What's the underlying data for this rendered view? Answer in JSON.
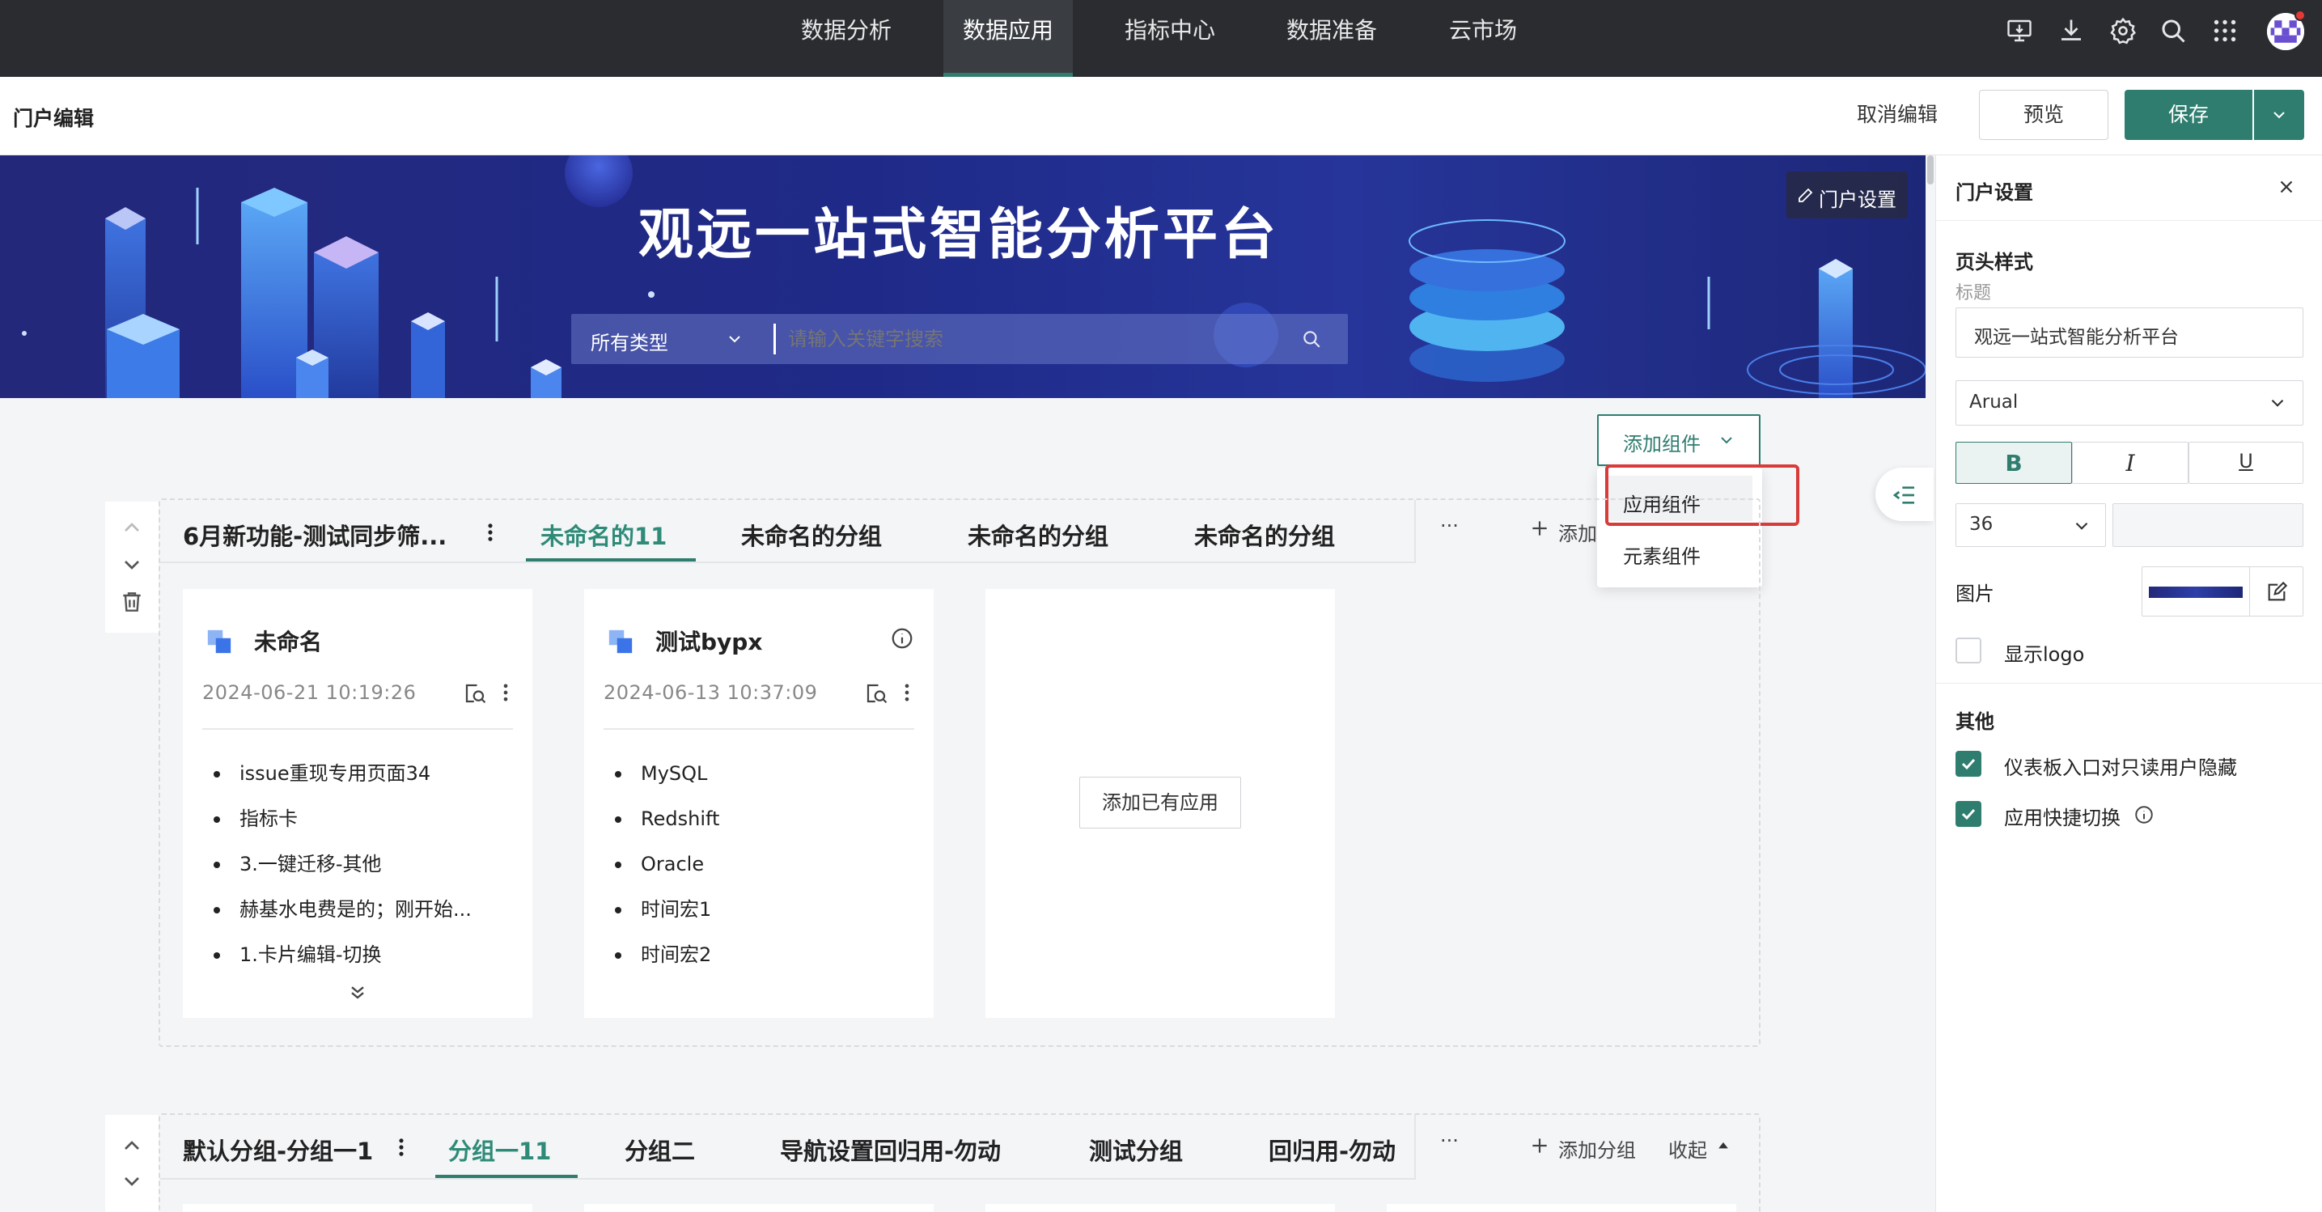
{
  "nav": {
    "items": [
      {
        "label": "数据分析"
      },
      {
        "label": "数据应用"
      },
      {
        "label": "指标中心"
      },
      {
        "label": "数据准备"
      },
      {
        "label": "云市场"
      }
    ],
    "active_index": 1
  },
  "toolbar": {
    "title": "门户编辑",
    "cancel_label": "取消编辑",
    "preview_label": "预览",
    "save_label": "保存"
  },
  "banner": {
    "title": "观远一站式智能分析平台",
    "type_select": "所有类型",
    "search_placeholder": "请输入关键字搜索",
    "settings_label": "门户设置"
  },
  "add_component": {
    "label": "添加组件",
    "menu": [
      "应用组件",
      "元素组件"
    ]
  },
  "group1": {
    "name": "6月新功能-测试同步筛...",
    "tabs": [
      "未命名的11",
      "未命名的分组",
      "未命名的分组",
      "未命名的分组"
    ],
    "active_tab": 0,
    "more": "···",
    "add_group_truncated": "添加",
    "cards": [
      {
        "title": "未命名",
        "date": "2024-06-21 10:19:26",
        "items": [
          "issue重现专用页面34",
          "指标卡",
          "3.一键迁移-其他",
          "赫基水电费是的；刚开始...",
          "1.卡片编辑-切换"
        ]
      },
      {
        "title": "测试bypx",
        "date": "2024-06-13 10:37:09",
        "items": [
          "MySQL",
          "Redshift",
          "Oracle",
          "时间宏1",
          "时间宏2"
        ]
      }
    ],
    "add_app_label": "添加已有应用"
  },
  "group2": {
    "name": "默认分组-分组一1",
    "tabs": [
      "分组一11",
      "分组二",
      "导航设置回归用-勿动",
      "测试分组",
      "回归用-勿动"
    ],
    "active_tab": 0,
    "more": "···",
    "add_group_label": "添加分组",
    "collapse_label": "收起"
  },
  "panel": {
    "title": "门户设置",
    "section_header": "页头样式",
    "title_label": "标题",
    "title_value": "观远一站式智能分析平台",
    "font_family": "Arual",
    "bold": "B",
    "italic": "I",
    "underline": "U",
    "font_size": "36",
    "image_label": "图片",
    "show_logo_label": "显示logo",
    "show_logo_checked": false,
    "section_other": "其他",
    "option1_label": "仪表板入口对只读用户隐藏",
    "option1_checked": true,
    "option2_label": "应用快捷切换",
    "option2_checked": true
  },
  "colors": {
    "accent": "#2e7d6f",
    "nav_bg": "#2a2c30",
    "banner_bg": "#23287a",
    "highlight": "#d93a3a"
  }
}
